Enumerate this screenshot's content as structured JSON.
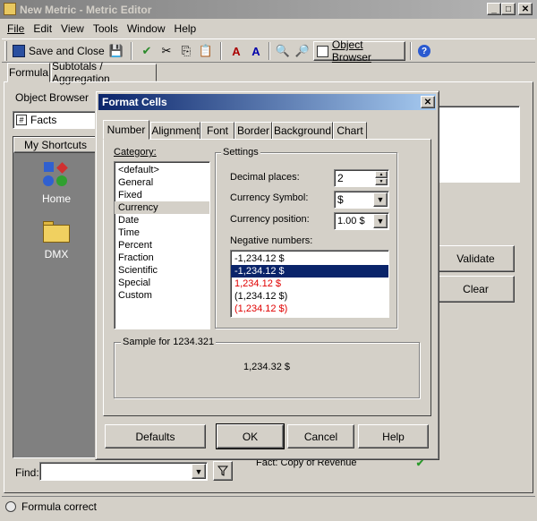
{
  "window": {
    "title": "New Metric - Metric Editor",
    "controls": [
      "_",
      "□",
      "✕"
    ]
  },
  "menu": [
    "File",
    "Edit",
    "View",
    "Tools",
    "Window",
    "Help"
  ],
  "toolbar": {
    "save_close": "Save and Close",
    "object_browser": "Object Browser"
  },
  "tabs": [
    "Formula",
    "Subtotals / Aggregation"
  ],
  "left_panel": {
    "header": "Object Browser",
    "combo_value": "Facts",
    "shortcuts_title": "My Shortcuts",
    "shortcuts": [
      {
        "label": "Home",
        "icon": "home-icon"
      },
      {
        "label": "DMX",
        "icon": "folder-icon"
      }
    ],
    "find_label": "Find:"
  },
  "right_panel": {
    "validate": "Validate",
    "clear": "Clear",
    "fact_text": "Fact: Copy of Revenue"
  },
  "status": {
    "text": "Formula correct"
  },
  "dialog": {
    "title": "Format Cells",
    "close": "✕",
    "tabs": [
      "Number",
      "Alignment",
      "Font",
      "Border",
      "Background",
      "Chart"
    ],
    "category_label": "Category:",
    "categories": [
      "<default>",
      "General",
      "Fixed",
      "Currency",
      "Date",
      "Time",
      "Percent",
      "Fraction",
      "Scientific",
      "Special",
      "Custom"
    ],
    "selected_category": "Currency",
    "settings_label": "Settings",
    "decimal_label": "Decimal places:",
    "decimal_value": "2",
    "symbol_label": "Currency Symbol:",
    "symbol_value": "$",
    "position_label": "Currency position:",
    "position_value": "1.00 $",
    "negative_label": "Negative numbers:",
    "negatives": [
      {
        "text": "-1,234.12 $",
        "red": false
      },
      {
        "text": "-1,234.12 $",
        "red": false
      },
      {
        "text": "1,234.12 $",
        "red": true
      },
      {
        "text": "(1,234.12 $)",
        "red": false
      },
      {
        "text": "(1,234.12 $)",
        "red": true
      }
    ],
    "selected_negative": 1,
    "sample_label": "Sample for 1234.321",
    "sample_value": "1,234.32 $",
    "buttons": {
      "defaults": "Defaults",
      "ok": "OK",
      "cancel": "Cancel",
      "help": "Help"
    }
  }
}
